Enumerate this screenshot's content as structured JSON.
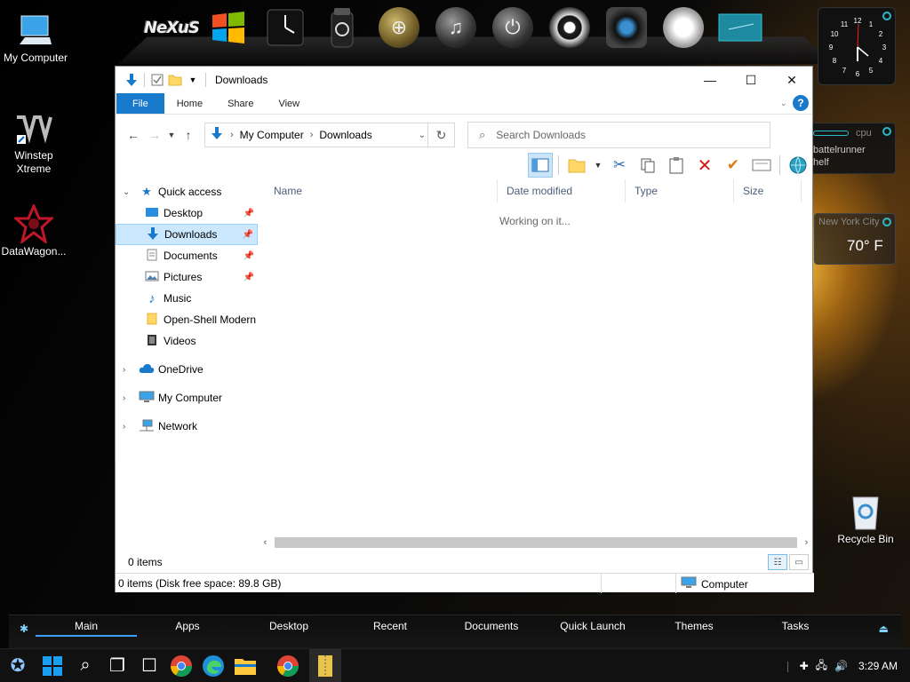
{
  "desktop": {
    "icons": [
      {
        "label": "My Computer"
      },
      {
        "label": "Winstep Xtreme"
      },
      {
        "label": "DataWagon..."
      },
      {
        "label": "Recycle Bin"
      }
    ]
  },
  "dock": {
    "items": [
      "nexus",
      "windows-logo",
      "clock",
      "biohazard",
      "globe",
      "bell",
      "power",
      "webcam",
      "camera",
      "speedometer",
      "sticky-note"
    ],
    "nexus_label": "NeXuS"
  },
  "widgets": {
    "clock_numbers": [
      "12",
      "1",
      "2",
      "3",
      "4",
      "5",
      "6",
      "7",
      "8",
      "9",
      "10",
      "11"
    ],
    "cpu_label": "cpu",
    "cpu_line1": "battelrunner",
    "cpu_line2": "helf",
    "weather_city": "New York City",
    "weather_temp": "70° F"
  },
  "window": {
    "title": "Downloads",
    "ribbon_tabs": [
      "File",
      "Home",
      "Share",
      "View"
    ],
    "help": "?",
    "address": {
      "root": "My Computer",
      "current": "Downloads"
    },
    "search": {
      "placeholder": "Search Downloads",
      "value": ""
    },
    "nav": {
      "quick_access": "Quick access",
      "quick_items": [
        "Desktop",
        "Downloads",
        "Documents",
        "Pictures",
        "Music",
        "Open-Shell Modern",
        "Videos"
      ],
      "onedrive": "OneDrive",
      "my_computer": "My Computer",
      "network": "Network"
    },
    "columns": [
      "Name",
      "Date modified",
      "Type",
      "Size"
    ],
    "working": "Working on it...",
    "item_count": "0 items",
    "status": "0 items (Disk free space: 89.8 GB)",
    "status_location": "Computer"
  },
  "menubar": {
    "items": [
      "Main",
      "Apps",
      "Desktop",
      "Recent",
      "Documents",
      "Quick Launch",
      "Themes",
      "Tasks"
    ],
    "active": "Main"
  },
  "taskbar": {
    "time": "3:29 AM"
  },
  "colors": {
    "accent": "#1979ca",
    "selection": "#cce8ff"
  }
}
